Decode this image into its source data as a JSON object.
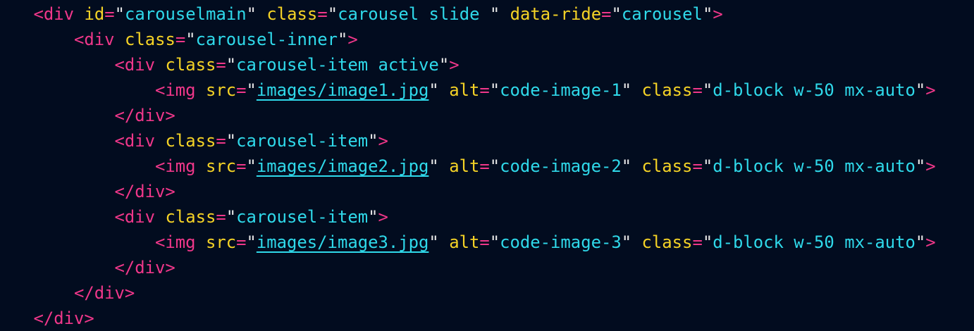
{
  "colors": {
    "background": "#020c1f",
    "tag": "#f0378a",
    "attribute": "#f5d326",
    "operator": "#f0378a",
    "string": "#2fd9ea",
    "quote": "#e8e8e8",
    "link_underline": "#2fd9ea"
  },
  "code": {
    "lines": [
      {
        "indent": 1,
        "tokens": [
          {
            "text": "<div",
            "kind": "tag"
          },
          {
            "text": " ",
            "kind": "space"
          },
          {
            "text": "id",
            "kind": "attribute"
          },
          {
            "text": "=",
            "kind": "operator"
          },
          {
            "text": "\"",
            "kind": "quote"
          },
          {
            "text": "carouselmain",
            "kind": "string"
          },
          {
            "text": "\"",
            "kind": "quote"
          },
          {
            "text": " ",
            "kind": "space"
          },
          {
            "text": "class",
            "kind": "attribute"
          },
          {
            "text": "=",
            "kind": "operator"
          },
          {
            "text": "\"",
            "kind": "quote"
          },
          {
            "text": "carousel slide ",
            "kind": "string"
          },
          {
            "text": "\"",
            "kind": "quote"
          },
          {
            "text": " ",
            "kind": "space"
          },
          {
            "text": "data-ride",
            "kind": "attribute"
          },
          {
            "text": "=",
            "kind": "operator"
          },
          {
            "text": "\"",
            "kind": "quote"
          },
          {
            "text": "carousel",
            "kind": "string"
          },
          {
            "text": "\"",
            "kind": "quote"
          },
          {
            "text": ">",
            "kind": "tag"
          }
        ]
      },
      {
        "indent": 2,
        "tokens": [
          {
            "text": "<div",
            "kind": "tag"
          },
          {
            "text": " ",
            "kind": "space"
          },
          {
            "text": "class",
            "kind": "attribute"
          },
          {
            "text": "=",
            "kind": "operator"
          },
          {
            "text": "\"",
            "kind": "quote"
          },
          {
            "text": "carousel-inner",
            "kind": "string"
          },
          {
            "text": "\"",
            "kind": "quote"
          },
          {
            "text": ">",
            "kind": "tag"
          }
        ]
      },
      {
        "indent": 3,
        "tokens": [
          {
            "text": "<div",
            "kind": "tag"
          },
          {
            "text": " ",
            "kind": "space"
          },
          {
            "text": "class",
            "kind": "attribute"
          },
          {
            "text": "=",
            "kind": "operator"
          },
          {
            "text": "\"",
            "kind": "quote"
          },
          {
            "text": "carousel-item active",
            "kind": "string"
          },
          {
            "text": "\"",
            "kind": "quote"
          },
          {
            "text": ">",
            "kind": "tag"
          }
        ]
      },
      {
        "indent": 4,
        "tokens": [
          {
            "text": "<img",
            "kind": "tag"
          },
          {
            "text": " ",
            "kind": "space"
          },
          {
            "text": "src",
            "kind": "attribute"
          },
          {
            "text": "=",
            "kind": "operator"
          },
          {
            "text": "\"",
            "kind": "quote"
          },
          {
            "text": "images/image1.jpg",
            "kind": "link"
          },
          {
            "text": "\"",
            "kind": "quote"
          },
          {
            "text": " ",
            "kind": "space"
          },
          {
            "text": "alt",
            "kind": "attribute"
          },
          {
            "text": "=",
            "kind": "operator"
          },
          {
            "text": "\"",
            "kind": "quote"
          },
          {
            "text": "code-image-1",
            "kind": "string"
          },
          {
            "text": "\"",
            "kind": "quote"
          },
          {
            "text": " ",
            "kind": "space"
          },
          {
            "text": "class",
            "kind": "attribute"
          },
          {
            "text": "=",
            "kind": "operator"
          },
          {
            "text": "\"",
            "kind": "quote"
          },
          {
            "text": "d-block w-50 mx-auto",
            "kind": "string"
          },
          {
            "text": "\"",
            "kind": "quote"
          },
          {
            "text": ">",
            "kind": "tag"
          }
        ]
      },
      {
        "indent": 3,
        "tokens": [
          {
            "text": "</div>",
            "kind": "tag"
          }
        ]
      },
      {
        "indent": 3,
        "tokens": [
          {
            "text": "<div",
            "kind": "tag"
          },
          {
            "text": " ",
            "kind": "space"
          },
          {
            "text": "class",
            "kind": "attribute"
          },
          {
            "text": "=",
            "kind": "operator"
          },
          {
            "text": "\"",
            "kind": "quote"
          },
          {
            "text": "carousel-item",
            "kind": "string"
          },
          {
            "text": "\"",
            "kind": "quote"
          },
          {
            "text": ">",
            "kind": "tag"
          }
        ]
      },
      {
        "indent": 4,
        "tokens": [
          {
            "text": "<img",
            "kind": "tag"
          },
          {
            "text": " ",
            "kind": "space"
          },
          {
            "text": "src",
            "kind": "attribute"
          },
          {
            "text": "=",
            "kind": "operator"
          },
          {
            "text": "\"",
            "kind": "quote"
          },
          {
            "text": "images/image2.jpg",
            "kind": "link"
          },
          {
            "text": "\"",
            "kind": "quote"
          },
          {
            "text": " ",
            "kind": "space"
          },
          {
            "text": "alt",
            "kind": "attribute"
          },
          {
            "text": "=",
            "kind": "operator"
          },
          {
            "text": "\"",
            "kind": "quote"
          },
          {
            "text": "code-image-2",
            "kind": "string"
          },
          {
            "text": "\"",
            "kind": "quote"
          },
          {
            "text": " ",
            "kind": "space"
          },
          {
            "text": "class",
            "kind": "attribute"
          },
          {
            "text": "=",
            "kind": "operator"
          },
          {
            "text": "\"",
            "kind": "quote"
          },
          {
            "text": "d-block w-50 mx-auto",
            "kind": "string"
          },
          {
            "text": "\"",
            "kind": "quote"
          },
          {
            "text": ">",
            "kind": "tag"
          }
        ]
      },
      {
        "indent": 3,
        "tokens": [
          {
            "text": "</div>",
            "kind": "tag"
          }
        ]
      },
      {
        "indent": 3,
        "tokens": [
          {
            "text": "<div",
            "kind": "tag"
          },
          {
            "text": " ",
            "kind": "space"
          },
          {
            "text": "class",
            "kind": "attribute"
          },
          {
            "text": "=",
            "kind": "operator"
          },
          {
            "text": "\"",
            "kind": "quote"
          },
          {
            "text": "carousel-item",
            "kind": "string"
          },
          {
            "text": "\"",
            "kind": "quote"
          },
          {
            "text": ">",
            "kind": "tag"
          }
        ]
      },
      {
        "indent": 4,
        "tokens": [
          {
            "text": "<img",
            "kind": "tag"
          },
          {
            "text": " ",
            "kind": "space"
          },
          {
            "text": "src",
            "kind": "attribute"
          },
          {
            "text": "=",
            "kind": "operator"
          },
          {
            "text": "\"",
            "kind": "quote"
          },
          {
            "text": "images/image3.jpg",
            "kind": "link"
          },
          {
            "text": "\"",
            "kind": "quote"
          },
          {
            "text": " ",
            "kind": "space"
          },
          {
            "text": "alt",
            "kind": "attribute"
          },
          {
            "text": "=",
            "kind": "operator"
          },
          {
            "text": "\"",
            "kind": "quote"
          },
          {
            "text": "code-image-3",
            "kind": "string"
          },
          {
            "text": "\"",
            "kind": "quote"
          },
          {
            "text": " ",
            "kind": "space"
          },
          {
            "text": "class",
            "kind": "attribute"
          },
          {
            "text": "=",
            "kind": "operator"
          },
          {
            "text": "\"",
            "kind": "quote"
          },
          {
            "text": "d-block w-50 mx-auto",
            "kind": "string"
          },
          {
            "text": "\"",
            "kind": "quote"
          },
          {
            "text": ">",
            "kind": "tag"
          }
        ]
      },
      {
        "indent": 3,
        "tokens": [
          {
            "text": "</div>",
            "kind": "tag"
          }
        ]
      },
      {
        "indent": 2,
        "tokens": [
          {
            "text": "</div>",
            "kind": "tag"
          }
        ]
      },
      {
        "indent": 1,
        "tokens": [
          {
            "text": "</div>",
            "kind": "tag"
          }
        ]
      }
    ]
  }
}
